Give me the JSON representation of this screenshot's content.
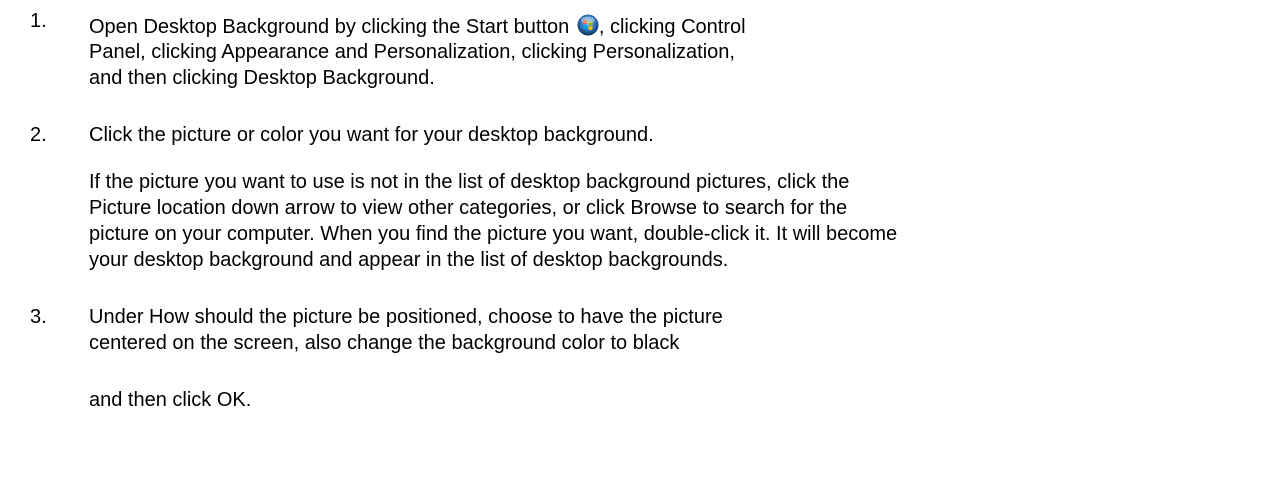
{
  "steps": [
    {
      "number": "1.",
      "lines": [
        "Open Desktop Background by clicking the Start button",
        ", clicking Control",
        "Panel, clicking Appearance and Personalization, clicking Personalization,",
        "and then clicking Desktop Background."
      ],
      "icon": "windows-start-orb-icon"
    },
    {
      "number": "2.",
      "lines": [
        "Click the picture or color you want for your desktop background."
      ],
      "note_lines": [
        "If the picture you want to use is not in the list of desktop background pictures, click the",
        "Picture location down arrow to view other categories, or click Browse to search for the",
        "picture on your computer. When you find the picture you want, double-click it. It will become",
        "your desktop background and appear in the list of desktop backgrounds."
      ]
    },
    {
      "number": "3.",
      "lines": [
        "Under How should the picture be positioned, choose to have the picture",
        "centered on the screen, also change the background color to black"
      ],
      "trailing_line": "and then click OK."
    }
  ]
}
